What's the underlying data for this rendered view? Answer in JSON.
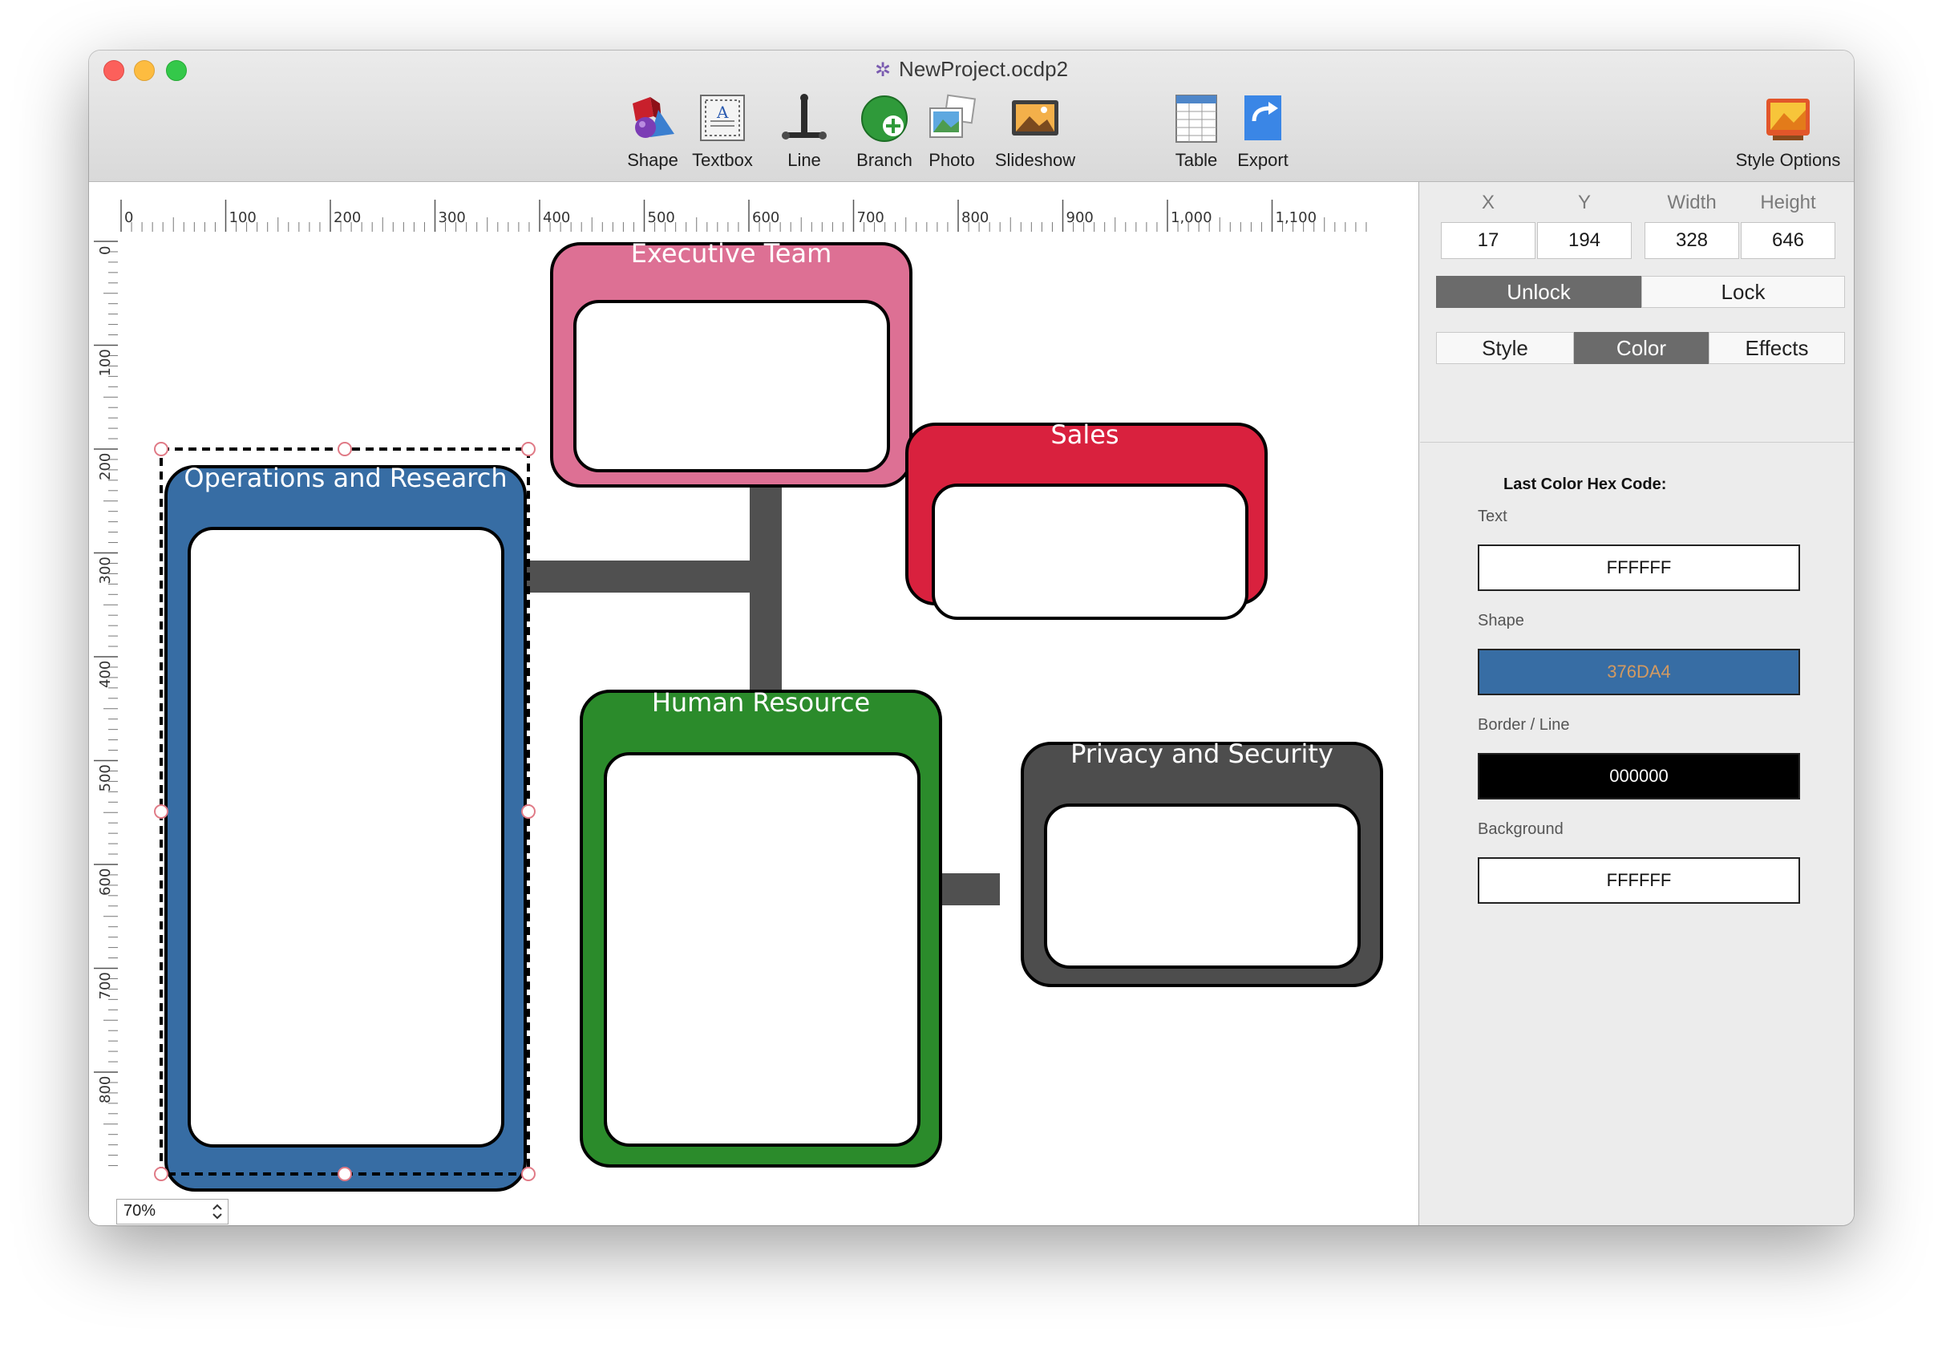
{
  "window": {
    "title": "NewProject.ocdp2"
  },
  "toolbar": {
    "items": [
      {
        "label": "Shape",
        "icon": "shape-icon"
      },
      {
        "label": "Textbox",
        "icon": "textbox-icon"
      },
      {
        "label": "Line",
        "icon": "line-icon"
      },
      {
        "label": "Branch",
        "icon": "branch-icon"
      },
      {
        "label": "Photo",
        "icon": "photo-icon"
      },
      {
        "label": "Slideshow",
        "icon": "slideshow-icon"
      },
      {
        "label": "Table",
        "icon": "table-icon"
      },
      {
        "label": "Export",
        "icon": "export-icon"
      }
    ],
    "style_options": {
      "label": "Style Options",
      "icon": "style-options-icon"
    }
  },
  "ruler": {
    "horizontal": [
      "0",
      "100",
      "200",
      "300",
      "400",
      "500",
      "600",
      "700",
      "800",
      "900",
      "1,000",
      "1,100"
    ],
    "vertical": [
      "0",
      "100",
      "200",
      "300",
      "400",
      "500",
      "600",
      "700",
      "800"
    ]
  },
  "canvas": {
    "zoom": "70%",
    "nodes": [
      {
        "title": "Executive Team",
        "color": "#DD7094"
      },
      {
        "title": "Sales",
        "color": "#D9213E"
      },
      {
        "title": "Operations and Research",
        "color": "#376DA4"
      },
      {
        "title": "Human Resource",
        "color": "#2B8B2B"
      },
      {
        "title": "Privacy and Security",
        "color": "#4D4D4D"
      }
    ],
    "connector_color": "#505050"
  },
  "inspector": {
    "geometry": {
      "x_label": "X",
      "y_label": "Y",
      "width_label": "Width",
      "height_label": "Height",
      "x": "17",
      "y": "194",
      "width": "328",
      "height": "646"
    },
    "lock": {
      "unlock": "Unlock",
      "lock": "Lock",
      "active": "Unlock"
    },
    "tabs": {
      "style": "Style",
      "color": "Color",
      "effects": "Effects",
      "active": "Color"
    },
    "color_panel": {
      "title": "Last Color Hex Code:",
      "text_label": "Text",
      "text_value": "FFFFFF",
      "text_fill": "#FFFFFF",
      "shape_label": "Shape",
      "shape_value": "376DA4",
      "shape_fill": "#376DA4",
      "border_label": "Border / Line",
      "border_value": "000000",
      "border_fill": "#000000",
      "background_label": "Background",
      "background_value": "FFFFFF",
      "background_fill": "#FFFFFF"
    }
  }
}
